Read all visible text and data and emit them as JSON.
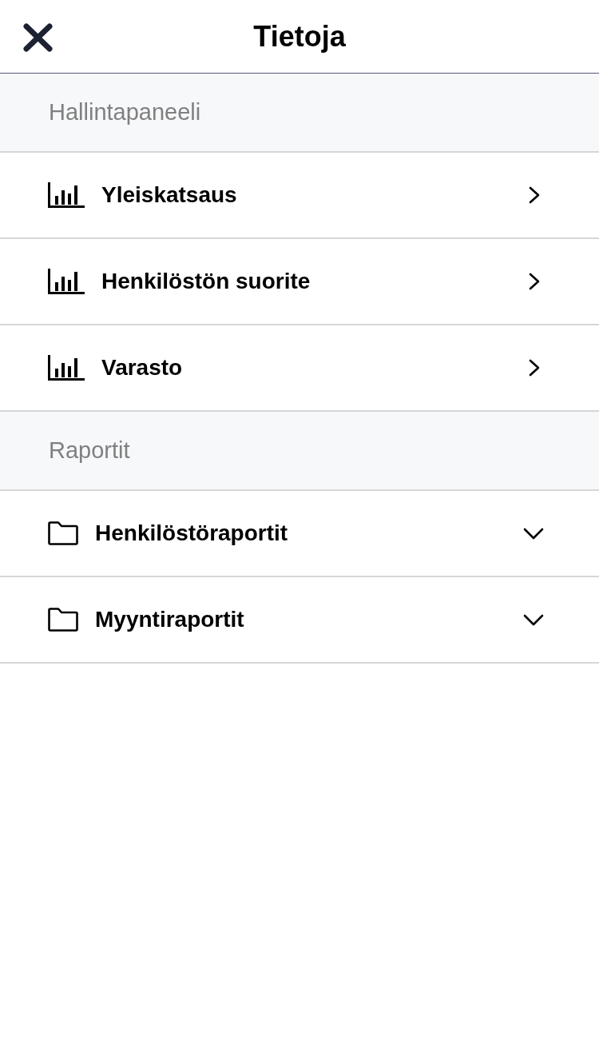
{
  "header": {
    "title": "Tietoja"
  },
  "sections": [
    {
      "title": "Hallintapaneeli",
      "items": [
        {
          "kind": "dashboard",
          "label": "Yleiskatsaus"
        },
        {
          "kind": "dashboard",
          "label": "Henkilöstön suorite"
        },
        {
          "kind": "dashboard",
          "label": "Varasto"
        }
      ]
    },
    {
      "title": "Raportit",
      "items": [
        {
          "kind": "folder",
          "label": "Henkilöstöraportit",
          "expanded": false
        },
        {
          "kind": "folder",
          "label": "Myyntiraportit",
          "expanded": false
        }
      ]
    }
  ]
}
